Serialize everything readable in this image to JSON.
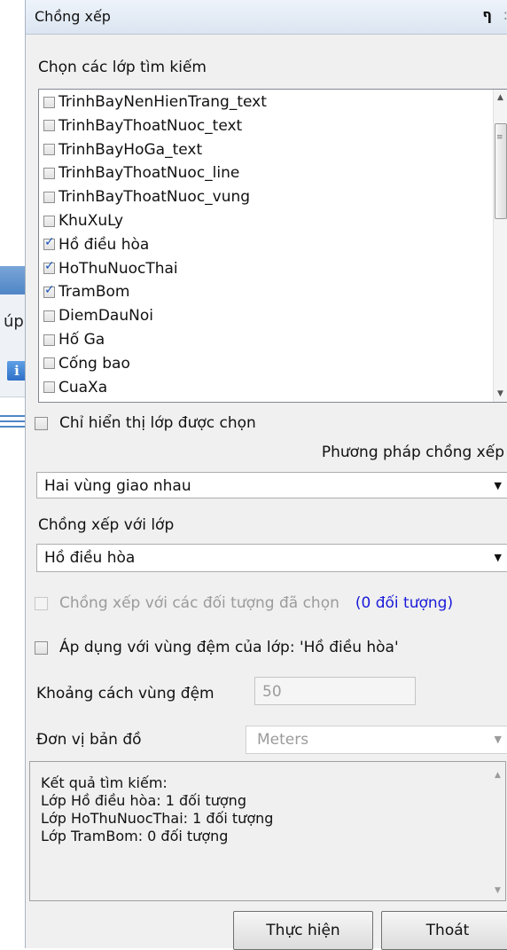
{
  "background_window": {
    "partial_text": "úp",
    "info_icon": "info-icon"
  },
  "panel": {
    "title": "Chồng xếp",
    "pin_icon": "pin-icon",
    "close_icon": "close-icon"
  },
  "search_layers": {
    "label": "Chọn các lớp tìm kiếm",
    "items": [
      {
        "label": "TrinhBayNenHienTrang_text",
        "checked": false
      },
      {
        "label": "TrinhBayThoatNuoc_text",
        "checked": false
      },
      {
        "label": "TrinhBayHoGa_text",
        "checked": false
      },
      {
        "label": "TrinhBayThoatNuoc_line",
        "checked": false
      },
      {
        "label": "TrinhBayThoatNuoc_vung",
        "checked": false
      },
      {
        "label": "KhuXuLy",
        "checked": false
      },
      {
        "label": "Hồ điều hòa",
        "checked": true
      },
      {
        "label": "HoThuNuocThai",
        "checked": true
      },
      {
        "label": "TramBom",
        "checked": true
      },
      {
        "label": "DiemDauNoi",
        "checked": false
      },
      {
        "label": "Hố Ga",
        "checked": false
      },
      {
        "label": "Cống bao",
        "checked": false
      },
      {
        "label": "CuaXa",
        "checked": false
      }
    ]
  },
  "show_selected_only": {
    "label": "Chỉ hiển thị lớp được chọn",
    "checked": false
  },
  "method": {
    "label": "Phương pháp chồng xếp",
    "value": "Hai vùng giao nhau"
  },
  "overlay_layer": {
    "label": "Chồng xếp với lớp",
    "value": "Hồ điều hòa"
  },
  "selected_objects": {
    "label": "Chồng xếp với các đối tượng đã chọn",
    "count_text": "(0 đối tượng)",
    "checked": false
  },
  "apply_buffer": {
    "label": "Áp dụng với vùng đệm của lớp: 'Hồ điều hòa'",
    "checked": false
  },
  "buffer_distance": {
    "label": "Khoảng cách vùng đệm",
    "value": "50"
  },
  "map_unit": {
    "label": "Đơn vị bản đồ",
    "value": "Meters"
  },
  "results": {
    "lines": [
      "Kết quả tìm kiếm:",
      "Lớp Hồ điều hòa: 1 đối tượng",
      "Lớp HoThuNuocThai: 1 đối tượng",
      "Lớp TramBom: 0 đối tượng"
    ]
  },
  "buttons": {
    "execute": "Thực hiện",
    "exit": "Thoát"
  }
}
